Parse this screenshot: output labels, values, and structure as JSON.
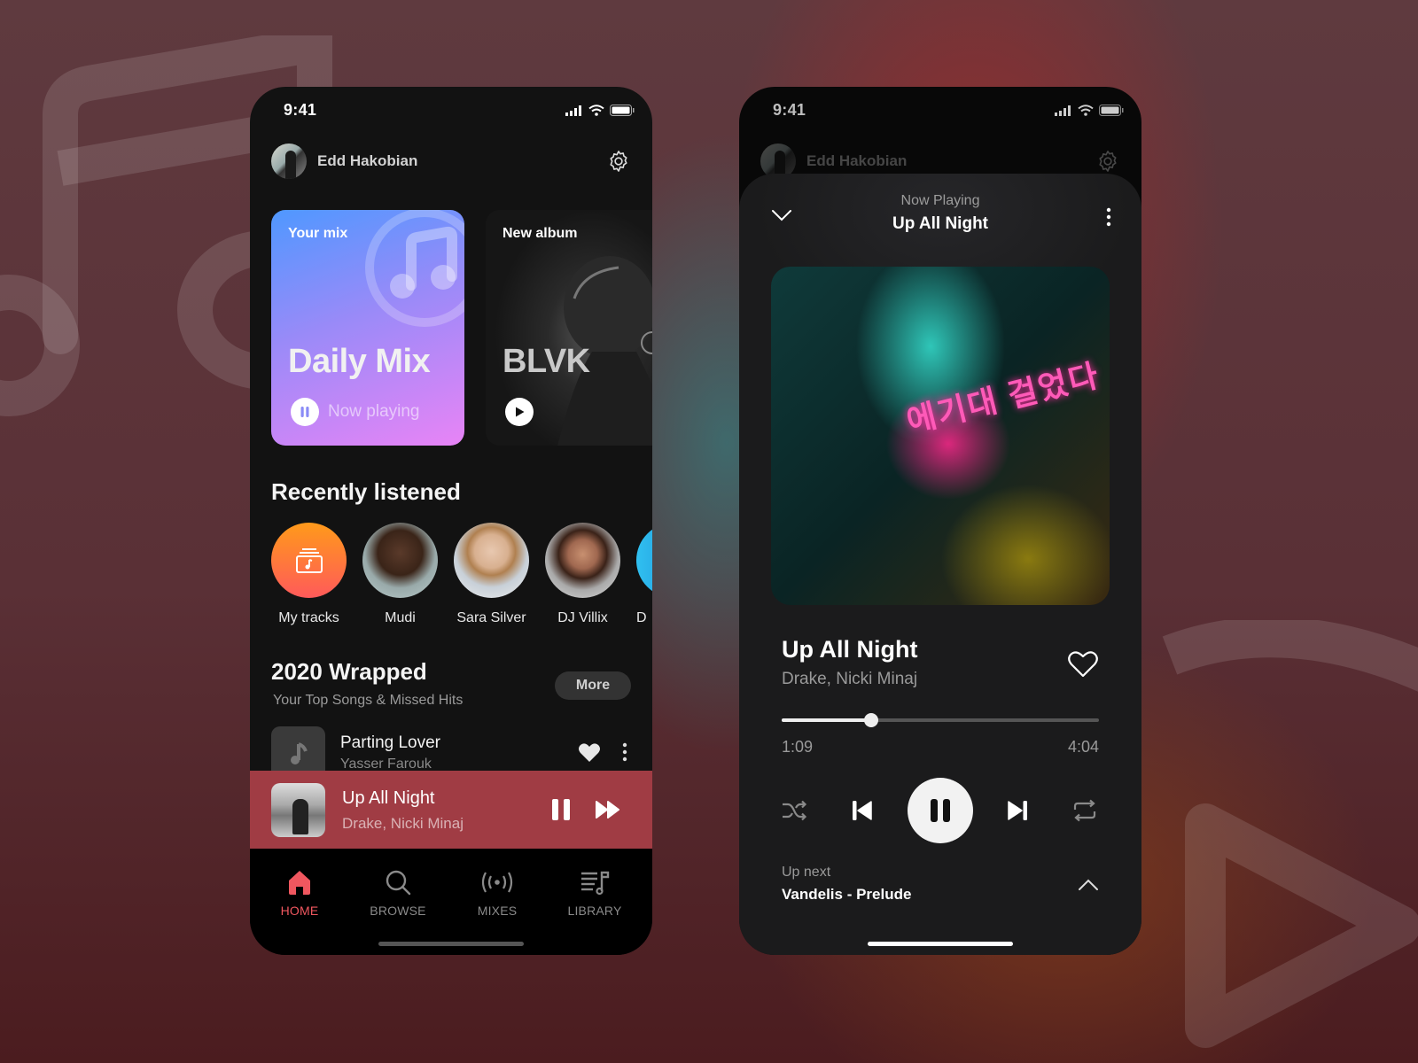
{
  "colors": {
    "accent": "#f0575f",
    "mini_player_bg": "#a03c44",
    "app_bg": "#121212",
    "mix_gradient": [
      "#4f98ff",
      "#e884f6"
    ],
    "my_tracks_gradient": [
      "#ff9a1a",
      "#ff5a5a"
    ]
  },
  "home": {
    "status": {
      "time": "9:41",
      "icons": [
        "signal-icon",
        "wifi-icon",
        "battery-icon"
      ]
    },
    "profile": {
      "name": "Edd Hakobian",
      "settings_icon": "gear-icon"
    },
    "cards": [
      {
        "label": "Your mix",
        "title": "Daily Mix",
        "action_label": "Now playing",
        "action_icon": "pause-icon",
        "decor_icon": "music-note-icon"
      },
      {
        "label": "New album",
        "title": "BLVK",
        "action_icon": "play-icon"
      }
    ],
    "recently_listened": {
      "title": "Recently listened",
      "items": [
        {
          "label": "My tracks",
          "icon": "music-library-icon"
        },
        {
          "label": "Mudi"
        },
        {
          "label": "Sara Silver"
        },
        {
          "label": "DJ Villix"
        },
        {
          "label": "D"
        }
      ]
    },
    "wrapped": {
      "title": "2020 Wrapped",
      "subtitle": "Your Top Songs & Missed Hits",
      "more_label": "More",
      "tracks": [
        {
          "title": "Parting Lover",
          "artist": "Yasser Farouk",
          "liked": true
        }
      ]
    },
    "mini_player": {
      "title": "Up All Night",
      "artist": "Drake, Nicki Minaj",
      "state": "playing"
    },
    "tabs": [
      {
        "label": "HOME",
        "icon": "home-icon",
        "active": true
      },
      {
        "label": "BROWSE",
        "icon": "search-icon",
        "active": false
      },
      {
        "label": "MIXES",
        "icon": "broadcast-icon",
        "active": false
      },
      {
        "label": "LIBRARY",
        "icon": "library-icon",
        "active": false
      }
    ]
  },
  "player": {
    "status": {
      "time": "9:41"
    },
    "profile": {
      "name": "Edd Hakobian"
    },
    "header": {
      "subtitle": "Now Playing",
      "title": "Up All Night"
    },
    "cover_text": "에기대 걸었다",
    "song": {
      "title": "Up All Night",
      "artist": "Drake, Nicki Minaj",
      "liked": false
    },
    "progress": {
      "elapsed": "1:09",
      "total": "4:04",
      "fraction": 0.283
    },
    "controls": [
      "shuffle-icon",
      "previous-icon",
      "pause-icon",
      "next-icon",
      "repeat-icon"
    ],
    "up_next": {
      "label": "Up next",
      "track": "Vandelis - Prelude"
    }
  }
}
